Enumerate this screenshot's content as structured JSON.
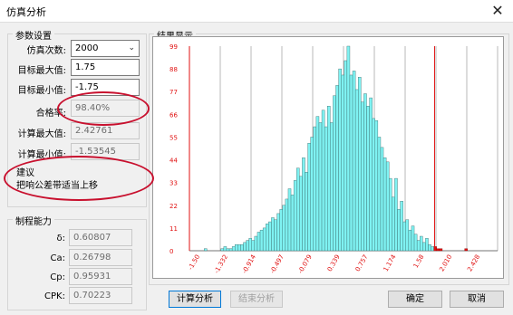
{
  "window": {
    "title": "仿真分析",
    "close_symbol": "✕"
  },
  "params": {
    "group_title": "参数设置",
    "sim_count_label": "仿真次数:",
    "sim_count_value": "2000",
    "target_max_label": "目标最大值:",
    "target_max_value": "1.75",
    "target_min_label": "目标最小值:",
    "target_min_value": "-1.75",
    "pass_rate_label": "合格率:",
    "pass_rate_value": "98.40%",
    "calc_max_label": "计算最大值:",
    "calc_max_value": "2.42761",
    "calc_min_label": "计算最小值:",
    "calc_min_value": "-1.53545"
  },
  "suggestion": {
    "title": "建议",
    "text": "把响公差带适当上移"
  },
  "capability": {
    "group_title": "制程能力",
    "rows": [
      {
        "label": "δ:",
        "value": "0.60807"
      },
      {
        "label": "Ca:",
        "value": "0.26798"
      },
      {
        "label": "Cp:",
        "value": "0.95931"
      },
      {
        "label": "CPK:",
        "value": "0.70223"
      }
    ]
  },
  "result": {
    "group_title": "结果显示"
  },
  "buttons": {
    "calculate": "计算分析",
    "end": "结束分析",
    "ok": "确定",
    "cancel": "取消"
  },
  "colors": {
    "in_spec": "#7ff2f2",
    "out_spec": "#e01010",
    "limit_line": "#e01010",
    "grid": "#8c8c8c",
    "highlight": "#c8102e"
  },
  "chart_data": {
    "type": "bar",
    "title": "",
    "xlabel": "",
    "ylabel": "",
    "y_ticks": [
      "0",
      "11",
      "22",
      "33",
      "44",
      "55",
      "66",
      "77",
      "88",
      "99"
    ],
    "ylim": [
      0,
      99
    ],
    "x_ticks": [
      "-1.50",
      "-1.332",
      "-0.914",
      "-0.497",
      "-0.079",
      "0.339",
      "0.757",
      "1.174",
      "1.58",
      "2.010",
      "2.428"
    ],
    "xlim": [
      -1.75,
      2.65
    ],
    "bin_start": -1.54,
    "bin_width": 0.04,
    "spec_limits": [
      -1.75,
      1.75
    ],
    "values": [
      1,
      0,
      0,
      0,
      0,
      0,
      1,
      2,
      1,
      1,
      2,
      3,
      3,
      3,
      4,
      5,
      6,
      5,
      7,
      9,
      10,
      11,
      13,
      14,
      16,
      15,
      18,
      20,
      22,
      25,
      30,
      27,
      34,
      40,
      36,
      45,
      38,
      52,
      55,
      60,
      65,
      62,
      68,
      60,
      70,
      62,
      75,
      80,
      88,
      85,
      92,
      99,
      85,
      87,
      78,
      84,
      72,
      76,
      70,
      74,
      64,
      63,
      55,
      50,
      45,
      43,
      35,
      26,
      35,
      20,
      24,
      14,
      15,
      10,
      12,
      8,
      5,
      7,
      4,
      6,
      3,
      2,
      2,
      1,
      1,
      0,
      0,
      0,
      0,
      0,
      0,
      0,
      0,
      1,
      0,
      0,
      0,
      0
    ]
  }
}
